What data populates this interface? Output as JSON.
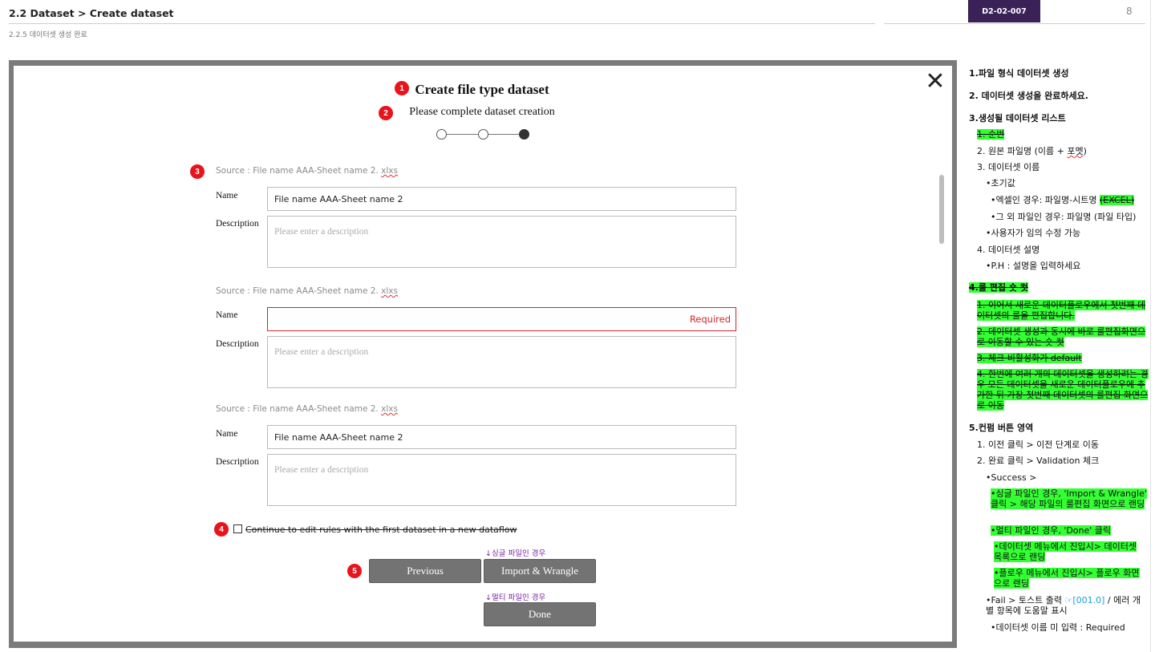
{
  "header": {
    "title": "2.2 Dataset > Create dataset",
    "subtitle": "2.2.5 데이터셋 생성 완료",
    "doc_id": "D2-02-007",
    "page_number": "8"
  },
  "modal": {
    "title": "Create file type dataset",
    "subtitle": "Please complete dataset creation",
    "close_icon": "close-icon",
    "steps": {
      "total": 3,
      "current": 3
    },
    "markers": [
      "1",
      "2",
      "3",
      "4",
      "5"
    ],
    "name_label": "Name",
    "description_label": "Description",
    "datasets": [
      {
        "source_prefix": "Source : File name AAA-Sheet name 2. ",
        "source_ext": "xlxs",
        "name_value": "File name AAA-Sheet name 2",
        "description_placeholder": "Please enter a description",
        "required_text": ""
      },
      {
        "source_prefix": "Source : File name AAA-Sheet name 2. ",
        "source_ext": "xlxs",
        "name_value": "",
        "description_placeholder": "Please enter a description",
        "required_text": "Required"
      },
      {
        "source_prefix": "Source : File name AAA-Sheet name 2. ",
        "source_ext": "xlxs",
        "name_value": "File name AAA-Sheet name 2",
        "description_placeholder": "Please enter a description",
        "required_text": ""
      }
    ],
    "checkbox_label": "Continue to edit rules with the first dataset in a new dataflow",
    "single_file_note": "↓싱글 파일인 경우",
    "multi_file_note": "↓멀티 파일인 경우",
    "buttons": {
      "previous": "Previous",
      "import_wrangle": "Import & Wrangle",
      "done": "Done"
    }
  },
  "notes": {
    "s1": "1.파일 형식 데이터셋 생성",
    "s2": "2. 데이터셋 생성을 완료하세요.",
    "s3": "3.생성될 데이터셋 리스트",
    "s3_1": "1. 순번",
    "s3_2_a": "2. 원본 파일명 (이름 + ",
    "s3_2_b": "포멧",
    "s3_2_c": ")",
    "s3_3": "3. 데이터셋 이름",
    "s3_3_a": "•초기값",
    "s3_3_b_a": "•엑셀인 경우: 파일명-시트명 ",
    "s3_3_b_b": "(EXCEL)",
    "s3_3_c": "•그 외 파일인 경우: 파일명 (파일 타입)",
    "s3_3_d": "•사용자가 임의 수정 가능",
    "s3_4": "4. 데이터셋 설명",
    "s3_4_a": "•P.H : 설명을 입력하세요",
    "s4": "4.룰 편집 숏 컷",
    "s4_1": "1. 이어서 새로운 데이터플로우에서 첫번째 데이터셋의 룰을 편집합니다.",
    "s4_2": "2. 데이터셋 생성과 동시에 바로 룰편집화면으로 이동할 수 있는 숏 컷",
    "s4_3": "3. 체크 비활성화가 default",
    "s4_4": "4. 한번에 여러 개의 데이터셋을 생성하려는 경우 모든 데이터셋을 새로운 데이터플로우에 추가한 뒤 가장 첫번째 데이터셋의 룰편집 화면으로 이동",
    "s5": "5.컨펌 버튼 영역",
    "s5_1": "1. 이전 클릭 > 이전 단계로 이동",
    "s5_2": "2. 완료 클릭 > Validation 체크",
    "s5_2_a": "•Success >",
    "s5_2_b": "•싱글 파일인 경우, 'Import & Wrangle' 클릭 > 해당 파일의 룰편집 화면으로 랜딩",
    "s5_2_c": "•멀티 파일인 경우, 'Done' 클릭",
    "s5_2_d": "•데이터셋 메뉴에서 진입시> 데이터셋 목록으로 랜딩",
    "s5_2_e": "•플로우 메뉴에서 진입시> 플로우 화면으로 랜딩",
    "s5_2_f_a": "•Fail > 토스트 출력 ",
    "s5_2_f_b": "☞[001.0]",
    "s5_2_f_c": " / 에러 개별 항목에 도움말 표시",
    "s5_2_g": "•데이터셋 이름 미 입력 : Required"
  }
}
